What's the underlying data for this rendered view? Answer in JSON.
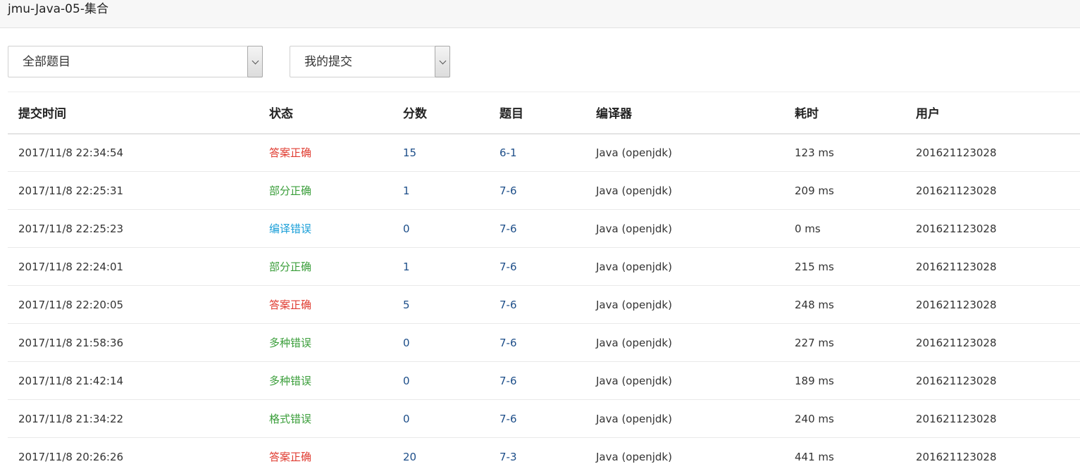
{
  "header": {
    "title": "jmu-Java-05-集合"
  },
  "filters": {
    "problem_select": "全部题目",
    "submission_select": "我的提交"
  },
  "colors": {
    "accepted": "#e03c31",
    "partial": "#3a9e3a",
    "compile_error": "#1a9fd8",
    "link": "#1d4e89"
  },
  "table": {
    "headers": [
      "提交时间",
      "状态",
      "分数",
      "题目",
      "编译器",
      "耗时",
      "用户"
    ],
    "rows": [
      {
        "time": "2017/11/8 22:34:54",
        "status": "答案正确",
        "status_kind": "accepted",
        "score": "15",
        "problem": "6-1",
        "compiler": "Java (openjdk)",
        "duration": "123 ms",
        "user": "201621123028"
      },
      {
        "time": "2017/11/8 22:25:31",
        "status": "部分正确",
        "status_kind": "partial",
        "score": "1",
        "problem": "7-6",
        "compiler": "Java (openjdk)",
        "duration": "209 ms",
        "user": "201621123028"
      },
      {
        "time": "2017/11/8 22:25:23",
        "status": "编译错误",
        "status_kind": "compile_error",
        "score": "0",
        "problem": "7-6",
        "compiler": "Java (openjdk)",
        "duration": "0 ms",
        "user": "201621123028"
      },
      {
        "time": "2017/11/8 22:24:01",
        "status": "部分正确",
        "status_kind": "partial",
        "score": "1",
        "problem": "7-6",
        "compiler": "Java (openjdk)",
        "duration": "215 ms",
        "user": "201621123028"
      },
      {
        "time": "2017/11/8 22:20:05",
        "status": "答案正确",
        "status_kind": "accepted",
        "score": "5",
        "problem": "7-6",
        "compiler": "Java (openjdk)",
        "duration": "248 ms",
        "user": "201621123028"
      },
      {
        "time": "2017/11/8 21:58:36",
        "status": "多种错误",
        "status_kind": "partial",
        "score": "0",
        "problem": "7-6",
        "compiler": "Java (openjdk)",
        "duration": "227 ms",
        "user": "201621123028"
      },
      {
        "time": "2017/11/8 21:42:14",
        "status": "多种错误",
        "status_kind": "partial",
        "score": "0",
        "problem": "7-6",
        "compiler": "Java (openjdk)",
        "duration": "189 ms",
        "user": "201621123028"
      },
      {
        "time": "2017/11/8 21:34:22",
        "status": "格式错误",
        "status_kind": "partial",
        "score": "0",
        "problem": "7-6",
        "compiler": "Java (openjdk)",
        "duration": "240 ms",
        "user": "201621123028"
      },
      {
        "time": "2017/11/8 20:26:26",
        "status": "答案正确",
        "status_kind": "accepted",
        "score": "20",
        "problem": "7-3",
        "compiler": "Java (openjdk)",
        "duration": "441 ms",
        "user": "201621123028"
      }
    ]
  }
}
